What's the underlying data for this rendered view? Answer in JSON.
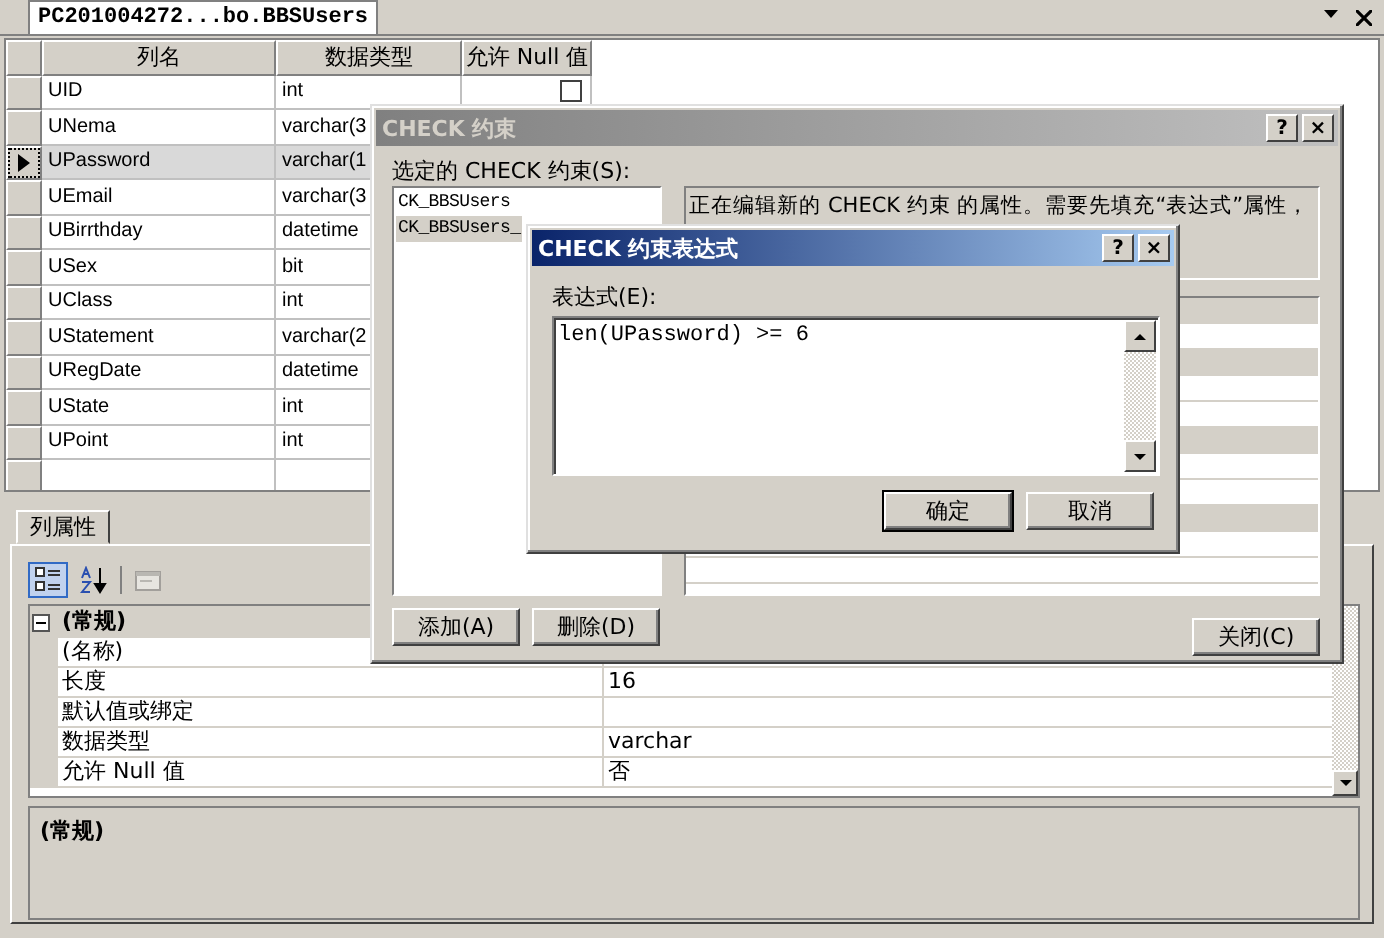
{
  "document_tab": {
    "label": "PC201004272...bo.BBSUsers"
  },
  "table": {
    "columns": [
      "列名",
      "数据类型",
      "允许 Null 值"
    ],
    "rows": [
      {
        "name": "UID",
        "type": "int",
        "allow_null": false,
        "selected": false
      },
      {
        "name": "UNema",
        "type": "varchar(3",
        "selected": false
      },
      {
        "name": "UPassword",
        "type": "varchar(1",
        "selected": true
      },
      {
        "name": "UEmail",
        "type": "varchar(3",
        "selected": false
      },
      {
        "name": "UBirrthday",
        "type": "datetime",
        "selected": false
      },
      {
        "name": "USex",
        "type": "bit",
        "selected": false
      },
      {
        "name": "UClass",
        "type": "int",
        "selected": false
      },
      {
        "name": "UStatement",
        "type": "varchar(2",
        "selected": false
      },
      {
        "name": "URegDate",
        "type": "datetime",
        "selected": false
      },
      {
        "name": "UState",
        "type": "int",
        "selected": false
      },
      {
        "name": "UPoint",
        "type": "int",
        "selected": false
      }
    ]
  },
  "properties_panel": {
    "tab": "列属性",
    "toolbar": [
      {
        "kind": "categorized",
        "selected": true,
        "disabled": false
      },
      {
        "kind": "alphabetical",
        "selected": false,
        "disabled": false
      },
      {
        "kind": "property_pages",
        "selected": false,
        "disabled": true
      }
    ],
    "categories": [
      {
        "label": "(常规)",
        "expanded": true,
        "children": [
          {
            "label": "(名称)"
          },
          {
            "label": "长度",
            "value": "16"
          },
          {
            "label": "默认值或绑定"
          },
          {
            "label": "数据类型",
            "value": "varchar"
          },
          {
            "label": "允许 Null 值",
            "value": "否"
          }
        ]
      }
    ],
    "description": "(常规)"
  },
  "check_dialog": {
    "title": "CHECK 约束",
    "active": false,
    "title_buttons": [
      "?",
      "×"
    ],
    "list_label": "选定的 CHECK 约束(S):",
    "constraints": [
      {
        "name": "CK_BBSUsers",
        "selected": false
      },
      {
        "name": "CK_BBSUsers_",
        "selected": true
      }
    ],
    "info": "正在编辑新的 CHECK 约束 的属性。需要先填充“表达式”属性，",
    "buttons": [
      "添加(A)",
      "删除(D)"
    ],
    "close_button": "关闭(C)"
  },
  "expression_dialog": {
    "title": "CHECK 约束表达式",
    "active": true,
    "title_buttons": [
      "?",
      "×"
    ],
    "label": "表达式(E):",
    "value": "len(UPassword) >= 6",
    "buttons": [
      {
        "label": "确定",
        "default": true
      },
      {
        "label": "取消",
        "default": false
      }
    ]
  }
}
